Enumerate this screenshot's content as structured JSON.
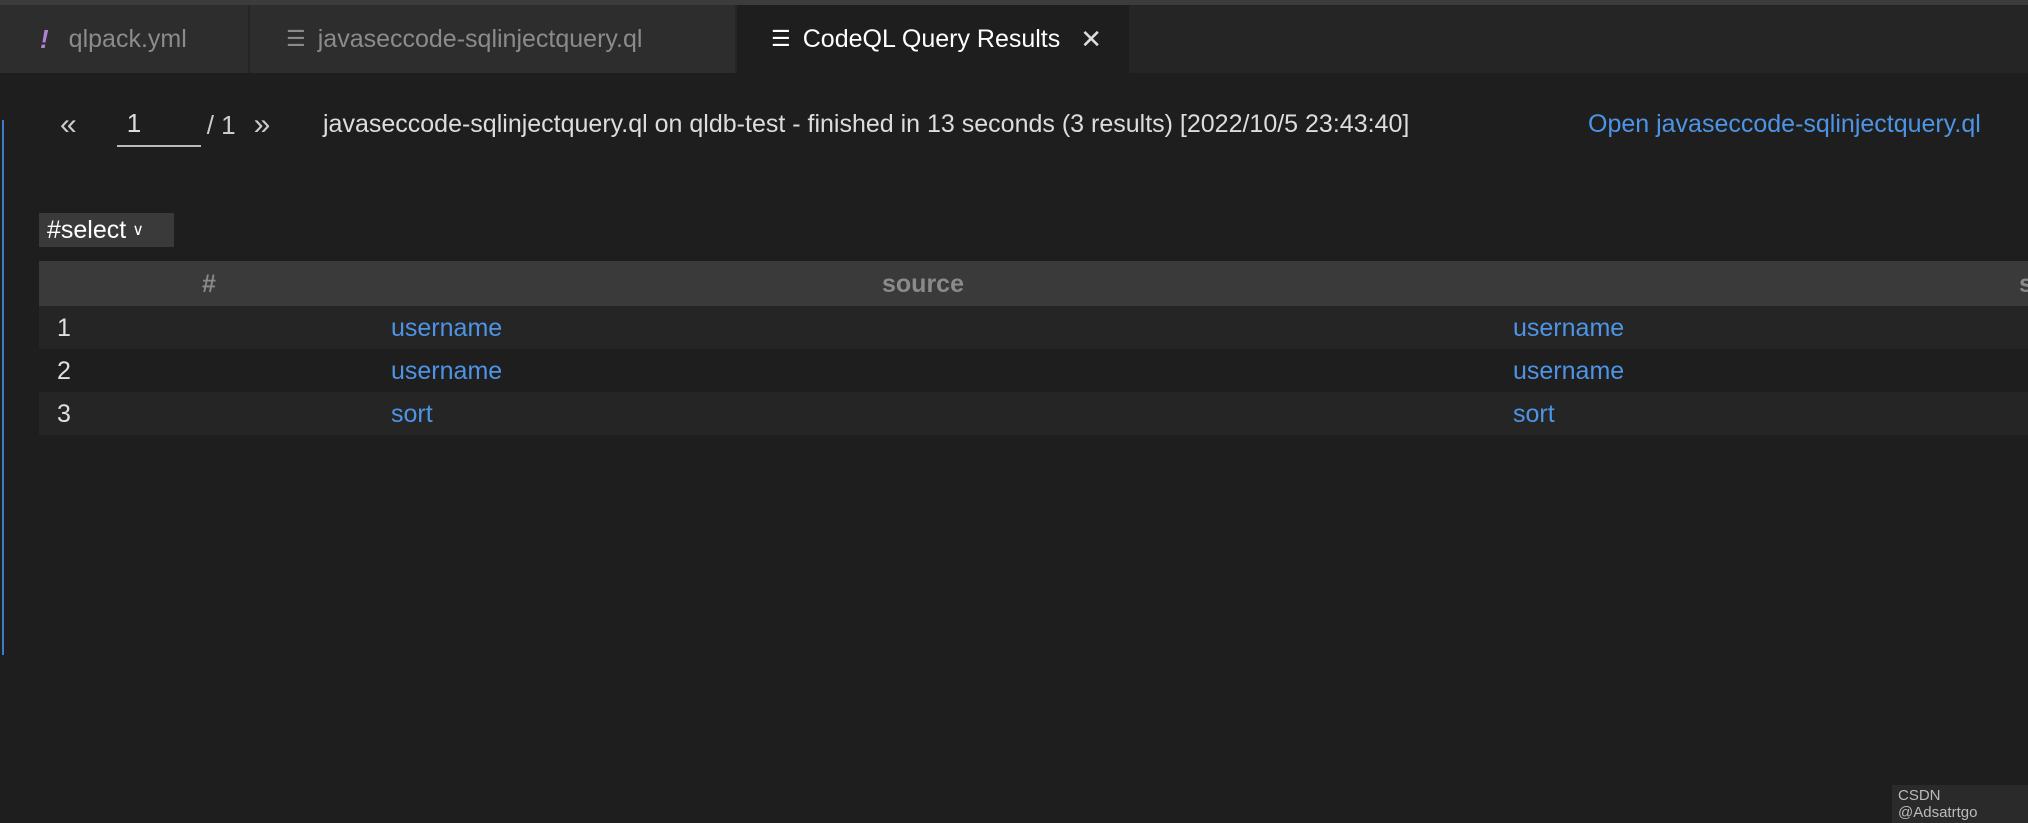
{
  "tabs": [
    {
      "label": "qlpack.yml",
      "icon": "exclamation-icon"
    },
    {
      "label": "javaseccode-sqlinjectquery.ql",
      "icon": "lines-icon"
    },
    {
      "label": "CodeQL Query Results",
      "icon": "lines-icon",
      "active": true
    }
  ],
  "pager": {
    "prev": "«",
    "page": "1",
    "total": "/ 1",
    "next": "»"
  },
  "status": "javaseccode-sqlinjectquery.ql on qldb-test - finished in 13 seconds (3 results) [2022/10/5 23:43:40]",
  "open_link": "Open javaseccode-sqlinjectquery.ql",
  "result_set": "#select",
  "table": {
    "headers": [
      "#",
      "source",
      "s"
    ],
    "rows": [
      [
        "1",
        "username",
        "username"
      ],
      [
        "2",
        "username",
        "username"
      ],
      [
        "3",
        "sort",
        "sort"
      ]
    ]
  },
  "watermark": "CSDN @Adsatrtgo",
  "colors": {
    "link": "#4e94e6",
    "background": "#1e1e1e",
    "header": "#3a3a3a"
  }
}
